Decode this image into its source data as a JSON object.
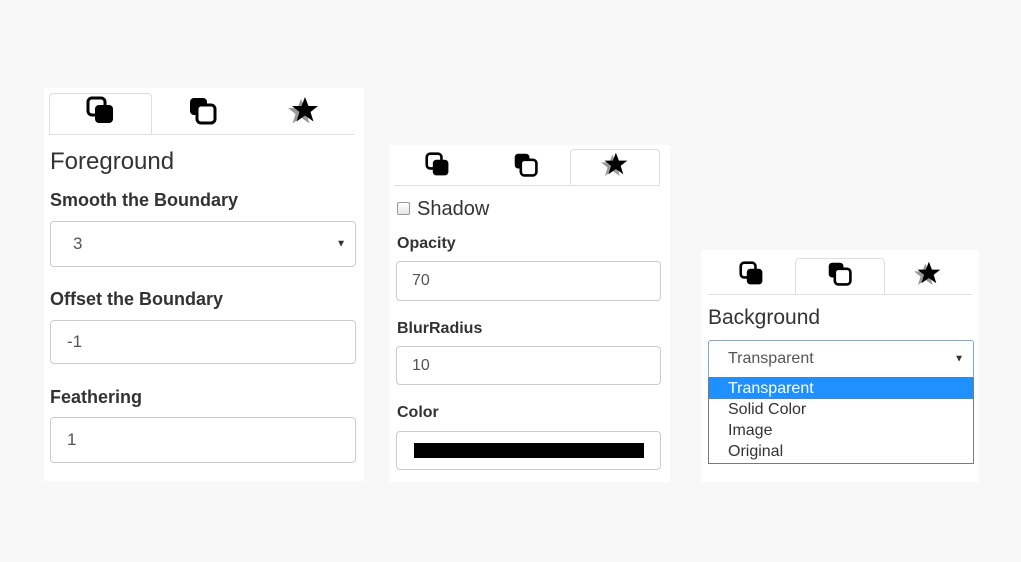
{
  "icons": {
    "foreground_tab": "foreground-layers-icon",
    "background_tab": "background-layers-icon",
    "effects_tab": "star-effects-icon"
  },
  "colors": {
    "page_bg": "#f8f8f9",
    "border": "#cccccc",
    "selected_option": "#1e90ff",
    "shadow_color": "#000000"
  },
  "panel_foreground": {
    "active_tab": "foreground",
    "heading": "Foreground",
    "smooth_label": "Smooth the Boundary",
    "smooth_value": "3",
    "offset_label": "Offset the Boundary",
    "offset_value": "-1",
    "feathering_label": "Feathering",
    "feathering_value": "1"
  },
  "panel_shadow": {
    "active_tab": "effects",
    "shadow_label": "Shadow",
    "shadow_checked": false,
    "opacity_label": "Opacity",
    "opacity_value": "70",
    "blur_label": "BlurRadius",
    "blur_value": "10",
    "color_label": "Color",
    "color_value": "#000000"
  },
  "panel_background": {
    "active_tab": "background",
    "heading": "Background",
    "select_value": "Transparent",
    "options": [
      "Transparent",
      "Solid Color",
      "Image",
      "Original"
    ],
    "selected_option": "Transparent"
  }
}
